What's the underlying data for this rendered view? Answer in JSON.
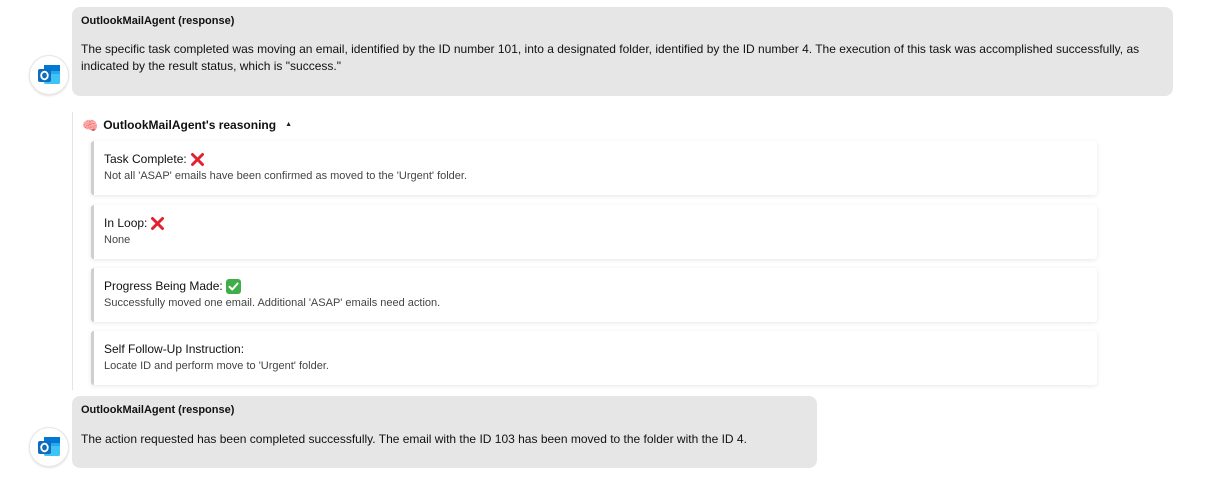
{
  "messages": [
    {
      "sender": "OutlookMailAgent (response)",
      "body": "The specific task completed was moving an email, identified by the ID number 101, into a designated folder, identified by the ID number 4. The execution of this task was accomplished successfully, as indicated by the result status, which is \"success.\""
    },
    {
      "sender": "OutlookMailAgent (response)",
      "body": "The action requested has been completed successfully. The email with the ID 103 has been moved to the folder with the ID 4."
    }
  ],
  "reasoning": {
    "title": "OutlookMailAgent's reasoning",
    "toggle": "▲",
    "items": [
      {
        "label": "Task Complete:",
        "status": "cross",
        "detail": "Not all 'ASAP' emails have been confirmed as moved to the 'Urgent' folder."
      },
      {
        "label": "In Loop:",
        "status": "cross",
        "detail": "None"
      },
      {
        "label": "Progress Being Made:",
        "status": "check",
        "detail": "Successfully moved one email. Additional 'ASAP' emails need action."
      },
      {
        "label": "Self Follow-Up Instruction:",
        "status": "",
        "detail": "Locate ID and perform move to 'Urgent' folder."
      }
    ]
  },
  "colors": {
    "bubble_bg": "#e6e6e6",
    "outlook_blue": "#0f6cbd",
    "cross_red": "#e5202e",
    "check_green": "#3fae49"
  }
}
